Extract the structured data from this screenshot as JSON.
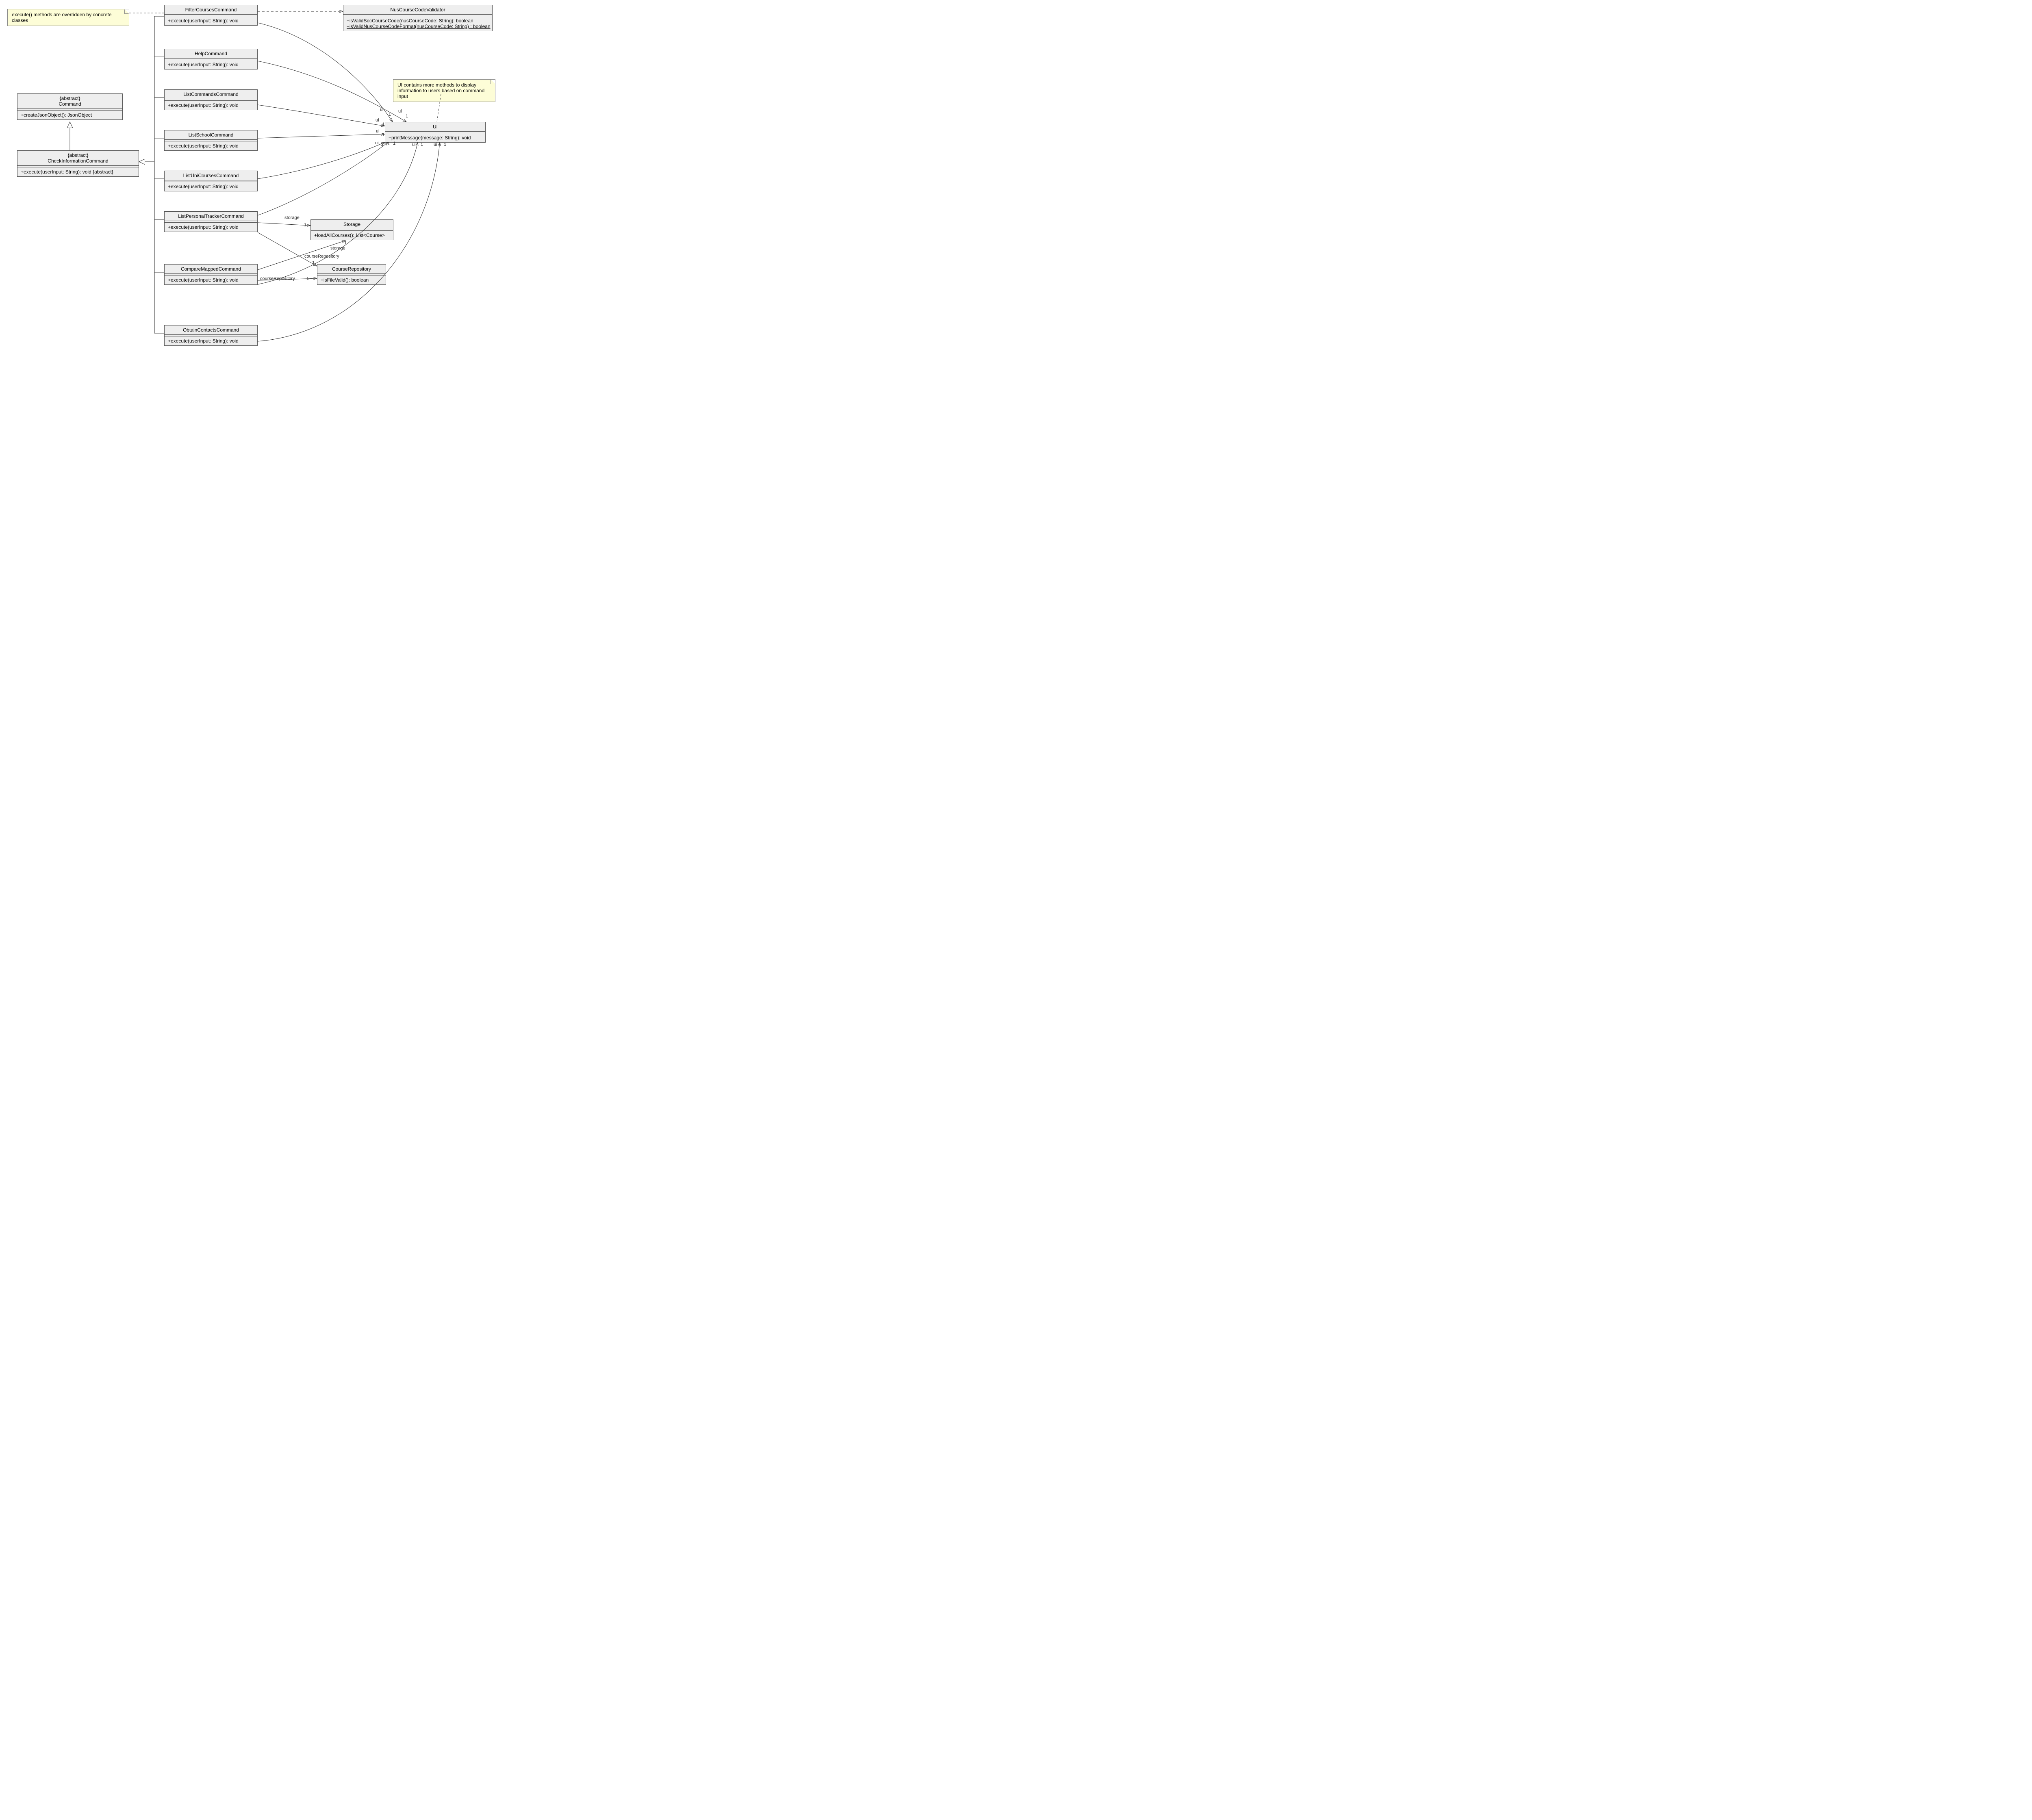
{
  "notes": {
    "executeOverride": "execute() methods are overridden by concrete classes",
    "uiMore": "UI contains more methods to display information to users based on command input"
  },
  "classes": {
    "command": {
      "stereotype": "{abstract}",
      "name": "Command",
      "op1": "+createJsonObject(): JsonObject"
    },
    "checkInfo": {
      "stereotype": "{abstract}",
      "name": "CheckInformationCommand",
      "op1": "+execute(userInput: String): void {abstract}"
    },
    "filterCourses": {
      "name": "FilterCoursesCommand",
      "op1": "+execute(userInput: String): void"
    },
    "help": {
      "name": "HelpCommand",
      "op1": "+execute(userInput: String): void"
    },
    "listCommands": {
      "name": "ListCommandsCommand",
      "op1": "+execute(userInput: String): void"
    },
    "listSchool": {
      "name": "ListSchoolCommand",
      "op1": "+execute(userInput: String): void"
    },
    "listUniCourses": {
      "name": "ListUniCoursesCommand",
      "op1": "+execute(userInput: String): void"
    },
    "listPersonalTracker": {
      "name": "ListPersonalTrackerCommand",
      "op1": "+execute(userInput: String): void"
    },
    "compareMapped": {
      "name": "CompareMappedCommand",
      "op1": "+execute(userInput: String): void"
    },
    "obtainContacts": {
      "name": "ObtainContactsCommand",
      "op1": "+execute(userInput: String): void"
    },
    "nusValidator": {
      "name": "NusCourseCodeValidator",
      "op1": "+isValidSocCourseCode(nusCourseCode: String): boolean",
      "op2": "+isValidNusCourseCodeFormat(nusCourseCode: String) : boolean"
    },
    "ui": {
      "name": "UI",
      "op1": "+printMessage(message: String): void"
    },
    "storage": {
      "name": "Storage",
      "op1": "+loadAllCourses(): List<Course>"
    },
    "courseRepo": {
      "name": "CourseRepository",
      "op1": "+isFileValid(): boolean"
    }
  },
  "labels": {
    "ui": "ui",
    "one": "1",
    "storage": "storage",
    "courseRepository": "courseRepository"
  }
}
